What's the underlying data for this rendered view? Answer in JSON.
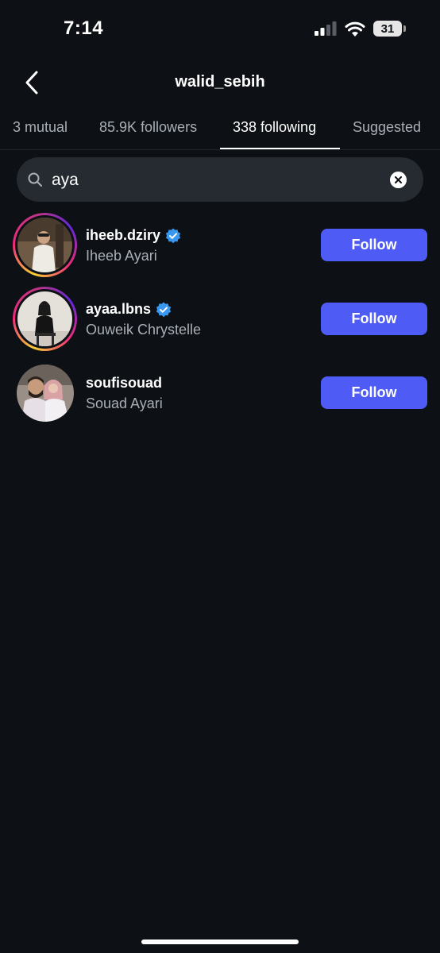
{
  "status_bar": {
    "time": "7:14",
    "battery": "31"
  },
  "header": {
    "back_icon": "chevron-left-icon",
    "title": "walid_sebih"
  },
  "tabs": [
    {
      "label": "3 mutual",
      "active": false
    },
    {
      "label": "85.9K followers",
      "active": false
    },
    {
      "label": "338 following",
      "active": true
    },
    {
      "label": "Suggested",
      "active": false
    }
  ],
  "search": {
    "value": "aya",
    "icon": "search-icon",
    "clear_icon": "clear-icon"
  },
  "results": [
    {
      "username": "iheeb.dziry",
      "full_name": "Iheeb Ayari",
      "verified": true,
      "has_story": true,
      "button": "Follow"
    },
    {
      "username": "ayaa.lbns",
      "full_name": "Ouweik Chrystelle",
      "verified": true,
      "has_story": true,
      "button": "Follow"
    },
    {
      "username": "soufisouad",
      "full_name": "Souad Ayari",
      "verified": false,
      "has_story": false,
      "button": "Follow"
    }
  ],
  "colors": {
    "background": "#0d1014",
    "follow_button": "#4f5bf5",
    "verified_badge": "#3897f0",
    "secondary_text": "#a9afb7"
  }
}
